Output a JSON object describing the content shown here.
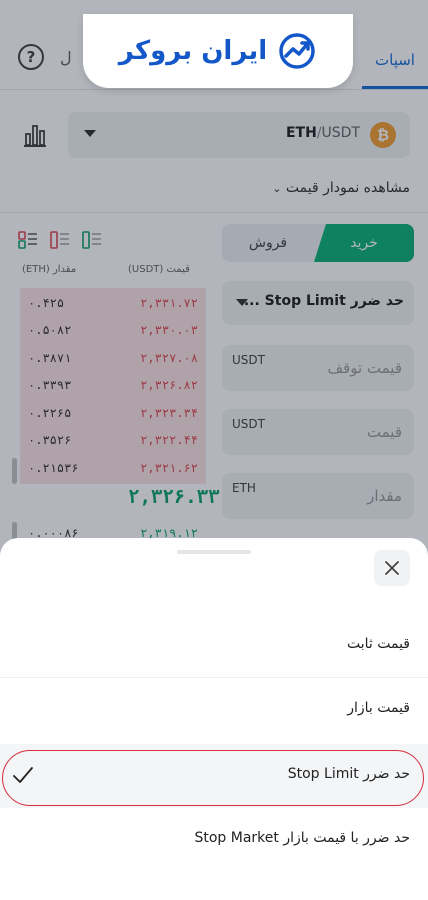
{
  "header": {
    "tab_spot": "اسپات",
    "tab_left_fragment": "ل",
    "logo_text": "ایران بروکر"
  },
  "pair": {
    "base": "ETH",
    "separator": "/",
    "quote": "USDT",
    "coin_icon_glyph": "₿"
  },
  "chart_link": "مشاهده نمودار قیمت",
  "trade_side": {
    "buy_label": "خرید",
    "sell_label": "فروش",
    "selected": "buy",
    "buy_color": "#10b37a"
  },
  "orderbook": {
    "header_price": "قیمت (USDT)",
    "header_amount": "مقدار (ETH)",
    "asks": [
      {
        "price": "۲,۳۳۱.۷۲",
        "amount": "۰.۴۲۵"
      },
      {
        "price": "۲,۳۳۰.۰۳",
        "amount": "۰.۵۰۸۲"
      },
      {
        "price": "۲,۳۲۷.۰۸",
        "amount": "۰.۳۸۷۱"
      },
      {
        "price": "۲,۳۲۶.۸۲",
        "amount": "۰.۳۳۹۳"
      },
      {
        "price": "۲,۳۲۳.۳۴",
        "amount": "۰.۲۲۶۵"
      },
      {
        "price": "۲,۳۲۲.۴۴",
        "amount": "۰.۳۵۲۶"
      },
      {
        "price": "۲,۳۲۱.۶۲",
        "amount": "۰.۲۱۵۳۶"
      }
    ],
    "mid_price": "۲,۳۲۶.۳۳",
    "bids": [
      {
        "price": "۲,۳۱۹.۱۲",
        "amount": "۰.۰۰۰۸۶"
      }
    ],
    "ask_color": "#e04b55",
    "bid_color": "#10a26e"
  },
  "order_form": {
    "order_type_value": "حد ضرر Stop Limit ...",
    "stop_price_placeholder": "قیمت توقف",
    "stop_price_unit": "USDT",
    "price_placeholder": "قیمت",
    "price_unit": "USDT",
    "amount_placeholder": "مقدار",
    "amount_unit": "ETH"
  },
  "sheet": {
    "options": [
      {
        "label": "قیمت ثابت",
        "selected": false
      },
      {
        "label": "قیمت بازار",
        "selected": false
      },
      {
        "label": "حد ضرر Stop Limit",
        "selected": true
      },
      {
        "label": "حد ضرر با قیمت بازار Stop Market",
        "selected": false
      }
    ]
  }
}
